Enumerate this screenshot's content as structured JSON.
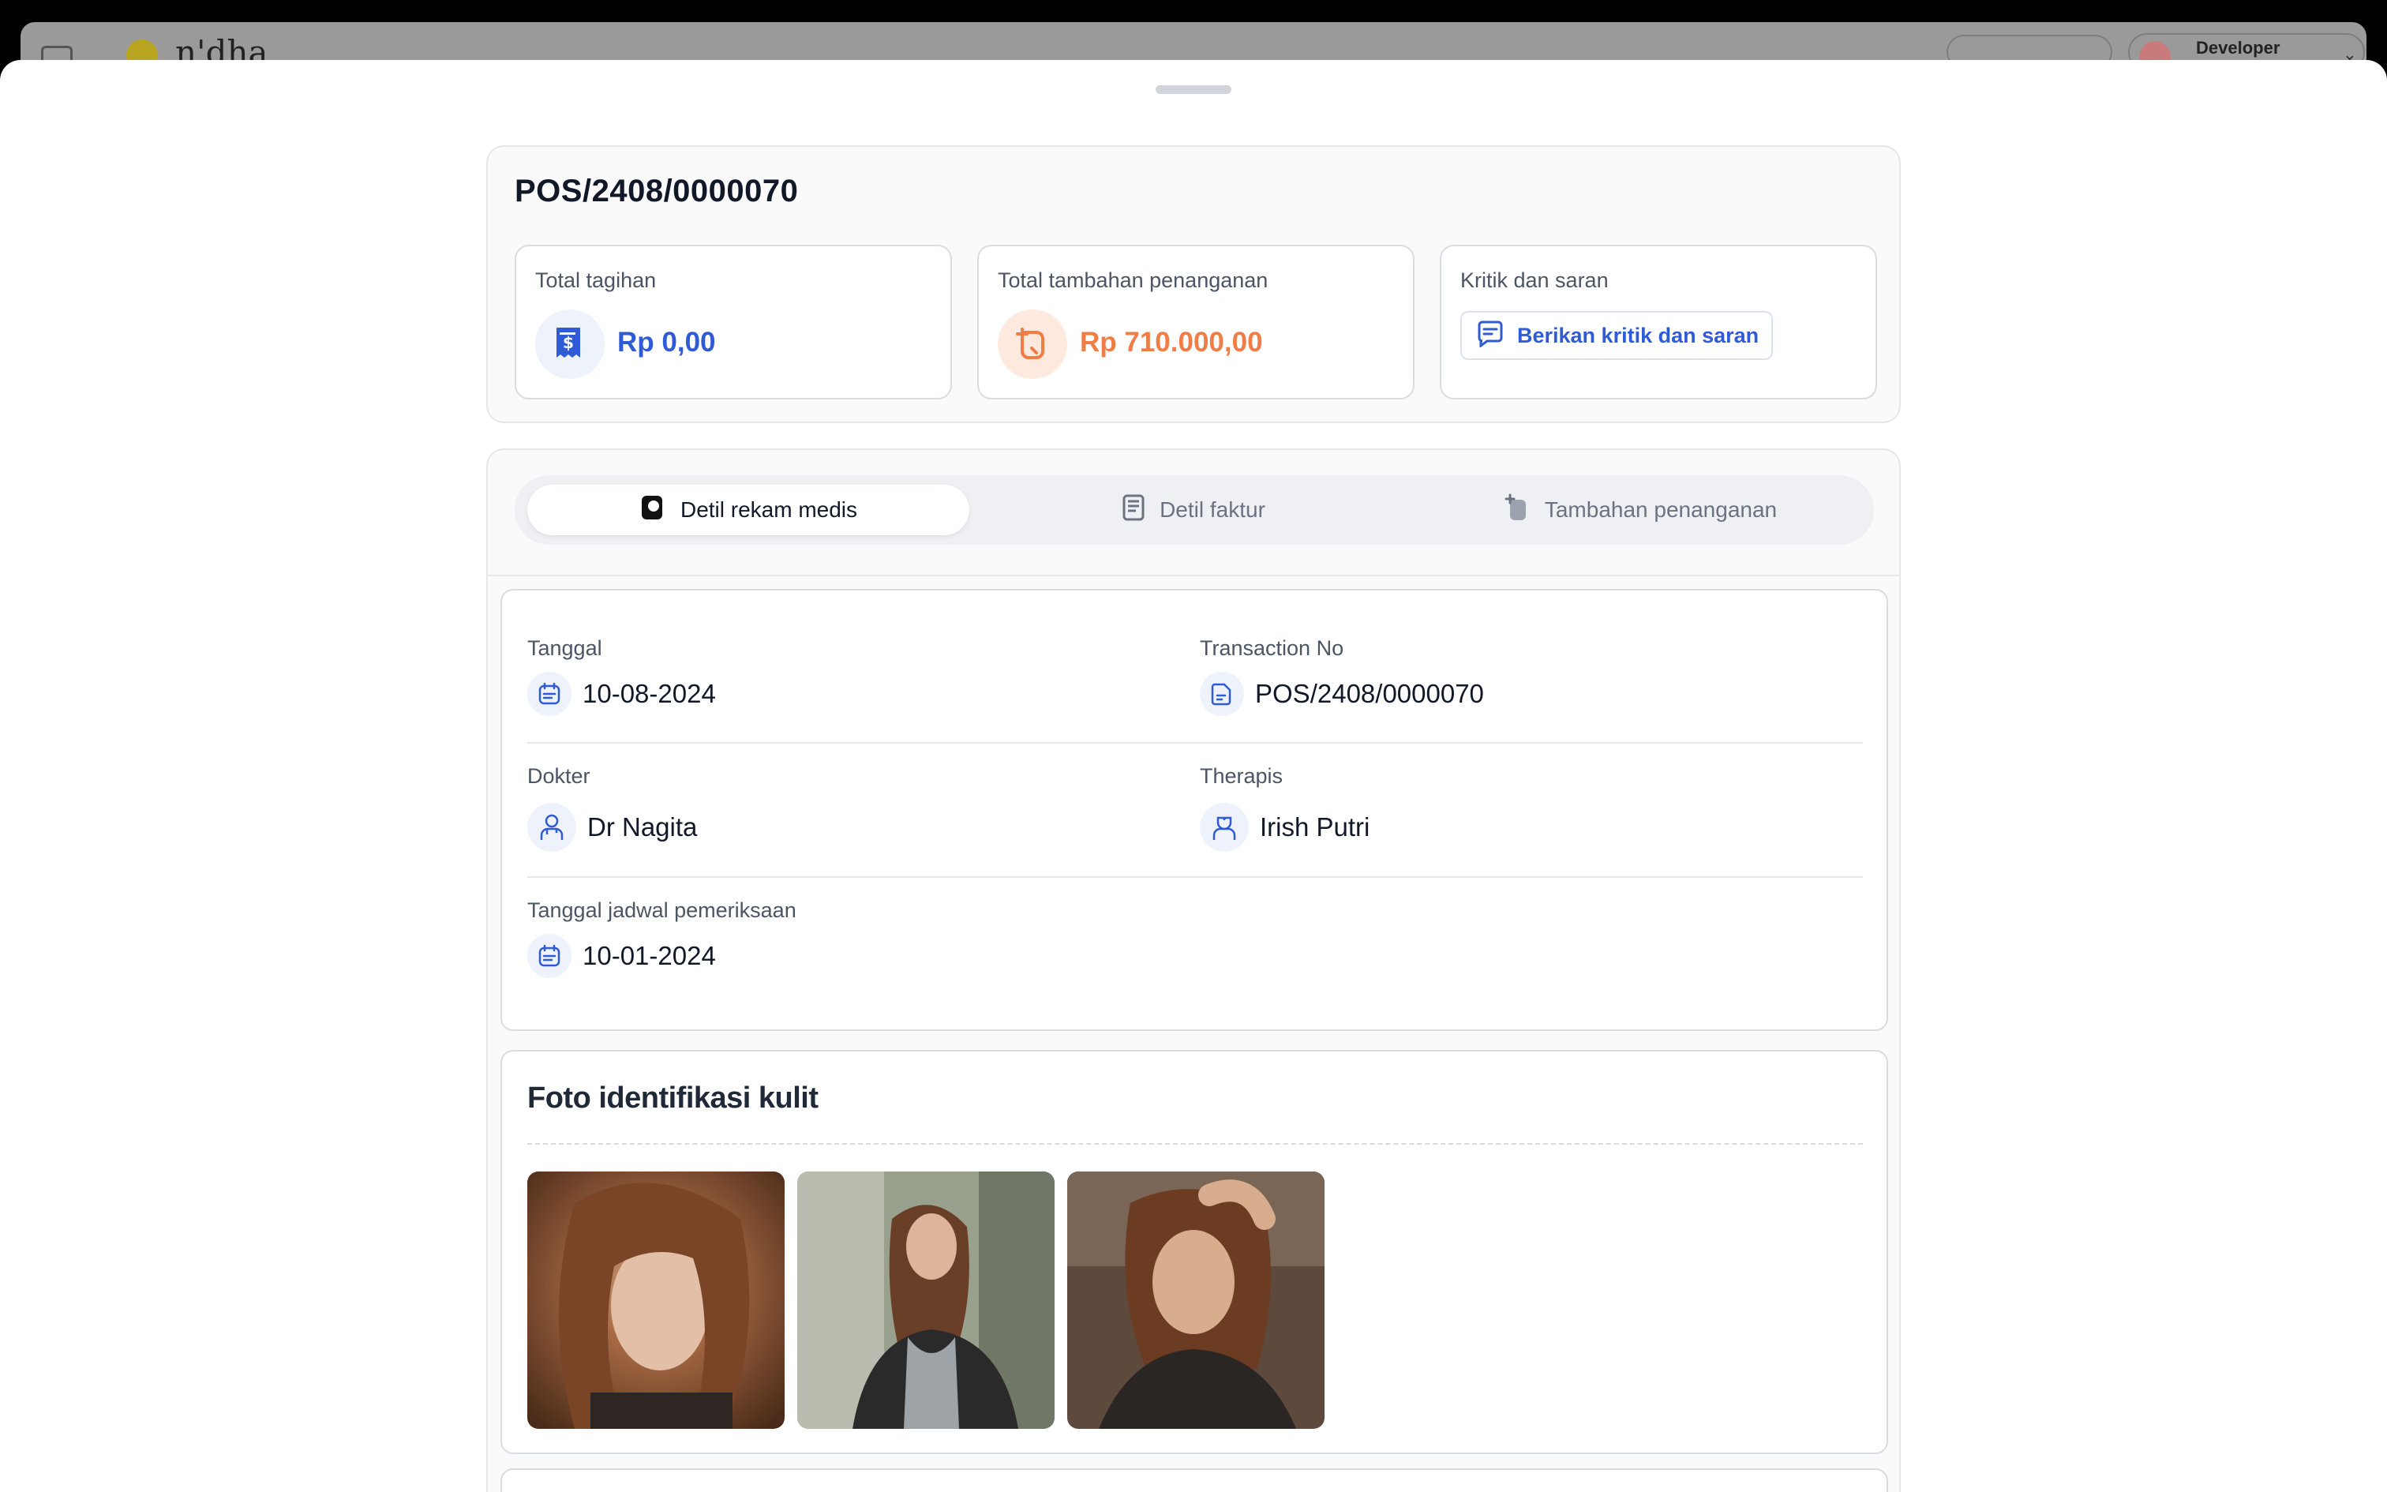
{
  "background_app": {
    "brand": "n'dha",
    "user_name": "Developer"
  },
  "invoice": {
    "number": "POS/2408/0000070",
    "stats": [
      {
        "label": "Total tagihan",
        "value": "Rp 0,00",
        "icon": "receipt-dollar-icon",
        "color": "#2f5bd6"
      },
      {
        "label": "Total tambahan penanganan",
        "value": "Rp 710.000,00",
        "icon": "add-treatment-icon",
        "color": "#ef7d45"
      },
      {
        "label": "Kritik dan saran",
        "button_label": "Berikan kritik dan saran",
        "icon": "message-icon"
      }
    ]
  },
  "tabs": [
    {
      "label": "Detil rekam medis",
      "icon": "medical-record-icon",
      "active": true
    },
    {
      "label": "Detil faktur",
      "icon": "invoice-icon",
      "active": false
    },
    {
      "label": "Tambahan penanganan",
      "icon": "add-treatment-icon",
      "active": false
    }
  ],
  "record": {
    "tanggal_label": "Tanggal",
    "tanggal_value": "10-08-2024",
    "transaction_label": "Transaction No",
    "transaction_value": "POS/2408/0000070",
    "dokter_label": "Dokter",
    "dokter_value": "Dr Nagita",
    "therapis_label": "Therapis",
    "therapis_value": "Irish Putri",
    "jadwal_label": "Tanggal jadwal pemeriksaan",
    "jadwal_value": "10-01-2024"
  },
  "photos": {
    "title": "Foto identifikasi kulit"
  },
  "colors": {
    "accent_blue": "#2f5bd6",
    "accent_orange": "#ef7d45",
    "icon_bg_blue": "#eef2fb",
    "icon_bg_orange": "#fde9de"
  }
}
